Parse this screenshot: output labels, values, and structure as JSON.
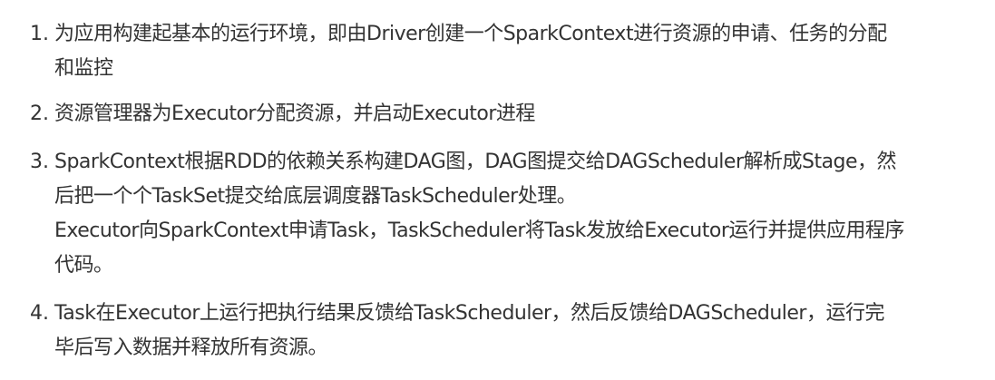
{
  "items": [
    {
      "number": "1.",
      "lines": [
        "为应用构建起基本的运行环境，即由Driver创建一个SparkContext进行资源的申请、任务的分配",
        "和监控"
      ]
    },
    {
      "number": "2.",
      "lines": [
        "资源管理器为Executor分配资源，并启动Executor进程"
      ]
    },
    {
      "number": "3.",
      "lines": [
        "SparkContext根据RDD的依赖关系构建DAG图，DAG图提交给DAGScheduler解析成Stage，然",
        "后把一个个TaskSet提交给底层调度器TaskScheduler处理。",
        "Executor向SparkContext申请Task，TaskScheduler将Task发放给Executor运行并提供应用程序",
        "代码。"
      ]
    },
    {
      "number": "4.",
      "lines": [
        "Task在Executor上运行把执行结果反馈给TaskScheduler，然后反馈给DAGScheduler，运行完",
        "毕后写入数据并释放所有资源。"
      ]
    }
  ]
}
